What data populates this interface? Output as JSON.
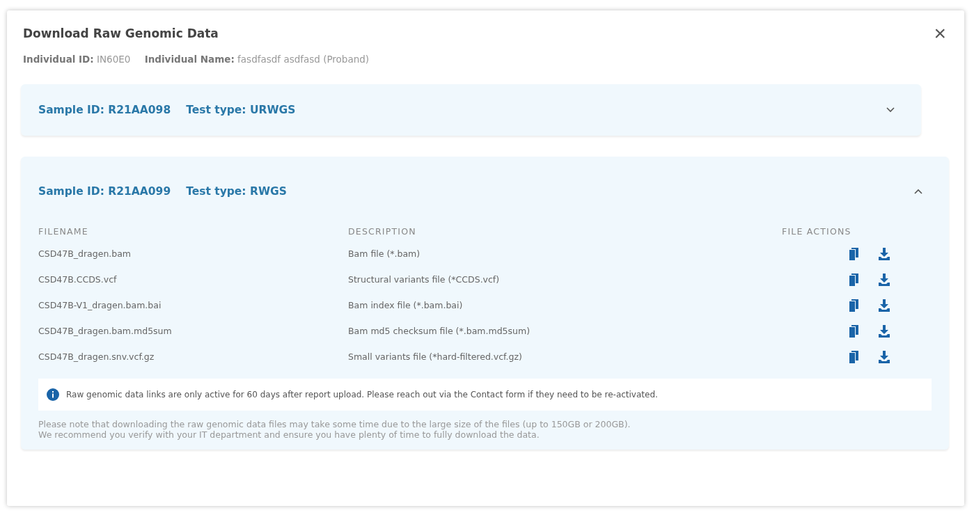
{
  "dialog": {
    "title": "Download Raw Genomic Data",
    "close": "×"
  },
  "individual": {
    "id_label": "Individual ID:",
    "id": "IN60E0",
    "name_label": "Individual Name:",
    "name": "fasdfasdf asdfasd (Proband)"
  },
  "samples": [
    {
      "sample_id": "Sample ID: R21AA098",
      "test_type": "Test type: URWGS",
      "expanded": false
    },
    {
      "sample_id": "Sample ID: R21AA099",
      "test_type": "Test type: RWGS",
      "expanded": true,
      "columns": [
        "FILENAME",
        "DESCRIPTION",
        "FILE ACTIONS"
      ],
      "files": [
        {
          "filename": "CSD47B_dragen.bam",
          "description": "Bam file (*.bam)"
        },
        {
          "filename": "CSD47B.CCDS.vcf",
          "description": "Structural variants file (*CCDS.vcf)"
        },
        {
          "filename": "CSD47B-V1_dragen.bam.bai",
          "description": "Bam index file (*.bam.bai)"
        },
        {
          "filename": "CSD47B_dragen.bam.md5sum",
          "description": "Bam md5 checksum file (*.bam.md5sum)"
        },
        {
          "filename": "CSD47B_dragen.snv.vcf.gz",
          "description": "Small variants file (*hard-filtered.vcf.gz)"
        }
      ],
      "info": "Raw genomic data links are only active for 60 days after report upload. Please reach out via the Contact form if they need to be re-activated.",
      "notes": [
        "Please note that downloading the raw genomic data files may take some time due to the large size of the files (up to 150GB or 200GB).",
        "We recommend you verify with your IT department and ensure you have plenty of time to fully download the data."
      ]
    }
  ]
}
